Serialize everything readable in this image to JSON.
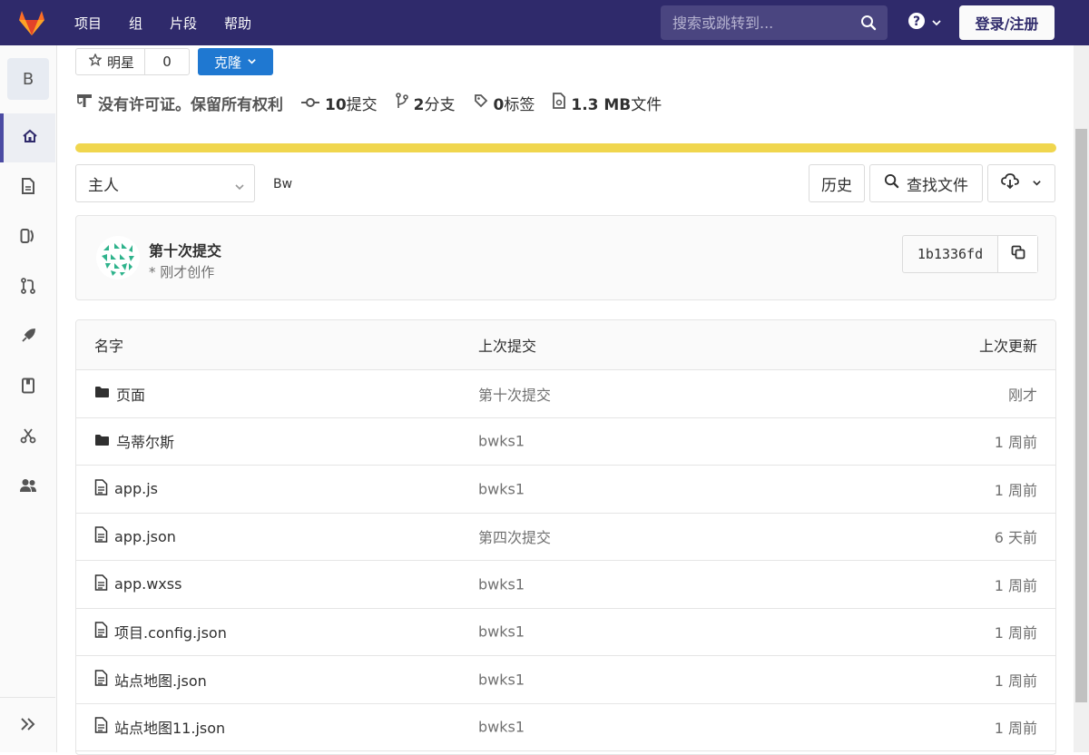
{
  "nav": {
    "links": [
      "项目",
      "组",
      "片段",
      "帮助"
    ],
    "search_placeholder": "搜索或跳转到...",
    "login_label": "登录/注册"
  },
  "sidebar": {
    "project_letter": "B",
    "items": [
      "home-icon",
      "file-icon",
      "issues-icon",
      "merge-request-icon",
      "rocket-icon",
      "wiki-icon",
      "snippets-icon",
      "members-icon"
    ],
    "active": "home-icon"
  },
  "project": {
    "star_label": "明星",
    "star_count": "0",
    "clone_label": "克隆",
    "license": "没有许可证。保留所有权利",
    "commits_num": "10",
    "commits_label": "提交",
    "branches_num": "2",
    "branches_label": "分支",
    "tags_num": "0",
    "tags_label": "标签",
    "files_size": "1.3 MB",
    "files_label": "文件",
    "accent_color": "#f0d64e"
  },
  "branch": {
    "selected": "主人",
    "breadcrumb": "Bw",
    "history_label": "历史",
    "find_file_label": "查找文件"
  },
  "last_commit": {
    "title": "第十次提交",
    "subtitle": "* 刚才创作",
    "sha": "1b1336fd"
  },
  "files": {
    "headers": [
      "名字",
      "上次提交",
      "上次更新"
    ],
    "rows": [
      {
        "type": "folder",
        "name": "页面",
        "commit": "第十次提交",
        "time": "刚才"
      },
      {
        "type": "folder",
        "name": "乌蒂尔斯",
        "commit": "bwks1",
        "time": "1 周前"
      },
      {
        "type": "file",
        "name": "app.js",
        "commit": "bwks1",
        "time": "1 周前"
      },
      {
        "type": "file",
        "name": "app.json",
        "commit": "第四次提交",
        "time": "6 天前"
      },
      {
        "type": "file",
        "name": "app.wxss",
        "commit": "bwks1",
        "time": "1 周前"
      },
      {
        "type": "file",
        "name": "项目.config.json",
        "commit": "bwks1",
        "time": "1 周前"
      },
      {
        "type": "file",
        "name": "站点地图.json",
        "commit": "bwks1",
        "time": "1 周前"
      },
      {
        "type": "file",
        "name": "站点地图11.json",
        "commit": "bwks1",
        "time": "1 周前"
      }
    ]
  }
}
